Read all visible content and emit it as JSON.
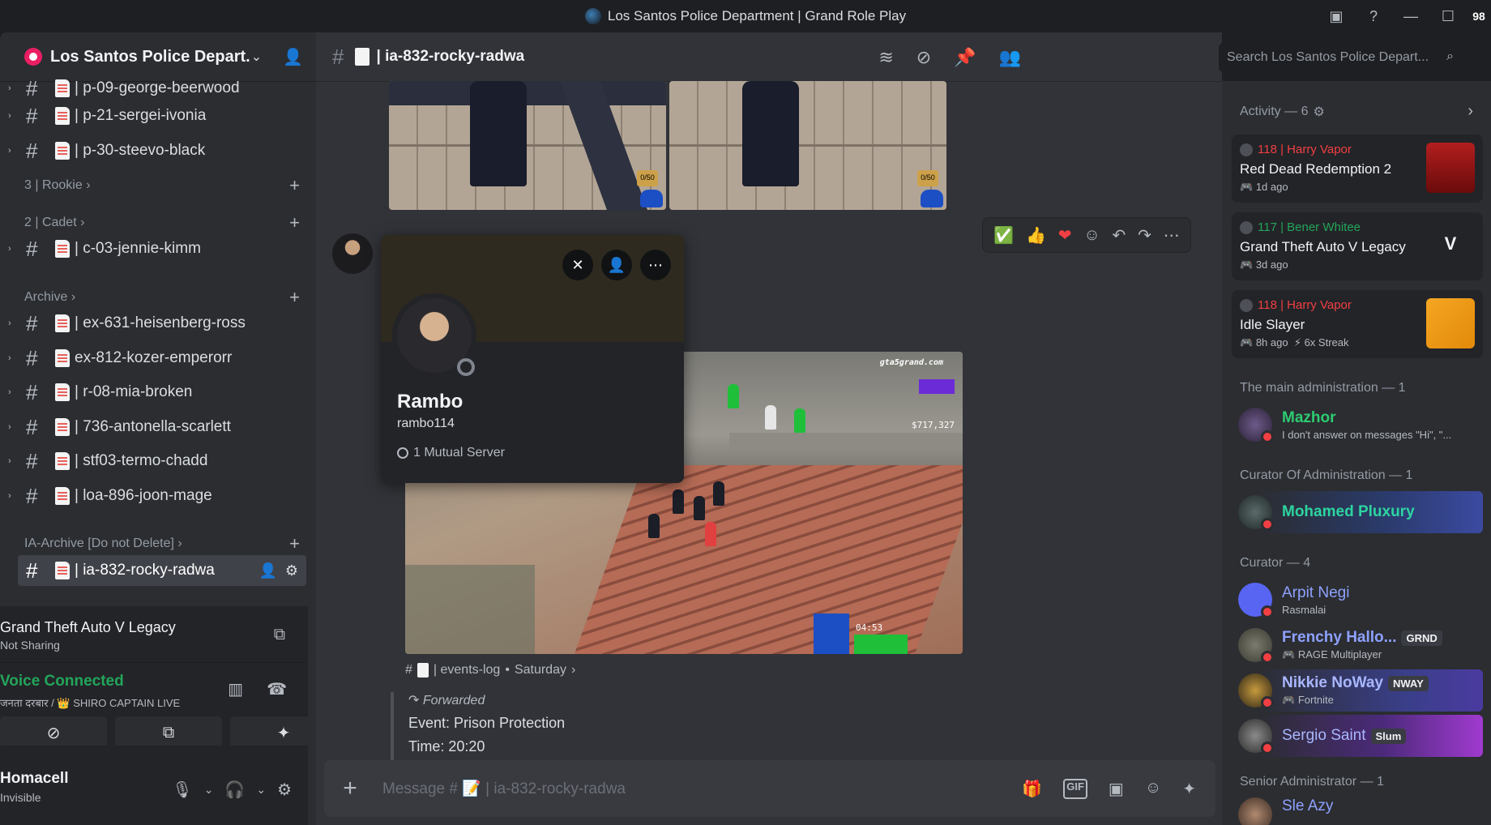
{
  "window": {
    "title": "Los Santos Police Department | Grand Role Play",
    "badge": "98"
  },
  "sidebar": {
    "server_name": "Los Santos Police Depart...",
    "channels_top": [
      {
        "name": "| p-09-george-beerwood"
      },
      {
        "name": "| p-21-sergei-ivonia"
      },
      {
        "name": "| p-30-steevo-black"
      }
    ],
    "cat_rookie": "3 | Rookie",
    "cat_cadet": "2 | Cadet",
    "cadet_channel": "| c-03-jennie-kimm",
    "cat_archive": "Archive",
    "archive_channels": [
      {
        "name": "| ex-631-heisenberg-ross"
      },
      {
        "name": "ex-812-kozer-emperorr"
      },
      {
        "name": "| r-08-mia-broken"
      },
      {
        "name": "| 736-antonella-scarlett"
      },
      {
        "name": "| stf03-termo-chadd"
      },
      {
        "name": "| loa-896-joon-mage"
      }
    ],
    "cat_ia_archive": "IA-Archive [Do not Delete]",
    "active_channel": "| ia-832-rocky-radwa"
  },
  "activity_panel": {
    "game": "Grand Theft Auto V Legacy",
    "sub": "Not Sharing"
  },
  "voice_panel": {
    "title": "Voice Connected",
    "sub": "जनता दरबार / 👑 SHIRO CAPTAIN LIVE"
  },
  "user_panel": {
    "name": "Homacell",
    "status": "Invisible"
  },
  "channel_header": {
    "title": "| ia-832-rocky-radwa",
    "search_placeholder": "Search Los Santos Police Depart..."
  },
  "profile_popup": {
    "display_name": "Rambo",
    "username": "rambo114",
    "mutual": "1 Mutual Server"
  },
  "screenshot_hud": {
    "site": "gta5grand.com",
    "money": "$717,327",
    "time": "04:53",
    "slots": "0/50"
  },
  "message": {
    "channel_link": "| events-log",
    "date": "Saturday",
    "forwarded_label": "Forwarded",
    "event_line": "Event: Prison Protection",
    "time_line": "Time: 20:20"
  },
  "composer": {
    "placeholder": "Message # 📝 | ia-832-rocky-radwa"
  },
  "members": {
    "activity_header": "Activity — 6",
    "activities": [
      {
        "user": "118 | Harry Vapor",
        "user_color": "#f23f43",
        "title": "Red Dead Redemption 2",
        "time": "1d ago",
        "extra": ""
      },
      {
        "user": "117 | Bener Whitee",
        "user_color": "#23a55a",
        "title": "Grand Theft Auto V Legacy",
        "time": "3d ago",
        "extra": ""
      },
      {
        "user": "118 | Harry Vapor",
        "user_color": "#f23f43",
        "title": "Idle Slayer",
        "time": "8h ago",
        "extra": "6x Streak"
      }
    ],
    "sec_main_admin": "The main administration — 1",
    "mazhor": {
      "name": "Mazhor",
      "status": "I don't answer on messages \"Hi\", \"..."
    },
    "sec_curator_admin": "Curator Of Administration — 1",
    "pluxury": {
      "name": "Mohamed Pluxury"
    },
    "sec_curator": "Curator — 4",
    "curators": [
      {
        "name": "Arpit Negi",
        "status": "Rasmalai",
        "tag": ""
      },
      {
        "name": "Frenchy Hallo...",
        "status": "RAGE Multiplayer",
        "tag": "GRND"
      },
      {
        "name": "Nikkie NoWay",
        "status": "Fortnite",
        "tag": "NWAY"
      },
      {
        "name": "Sergio Saint",
        "status": "",
        "tag": "Slum"
      }
    ],
    "sec_senior": "Senior Administrator — 1",
    "senior": {
      "name": "Sle Azy"
    }
  },
  "colors": {
    "accent": "#5865f2",
    "online_green": "#23a55a",
    "dnd_red": "#f23f43"
  }
}
